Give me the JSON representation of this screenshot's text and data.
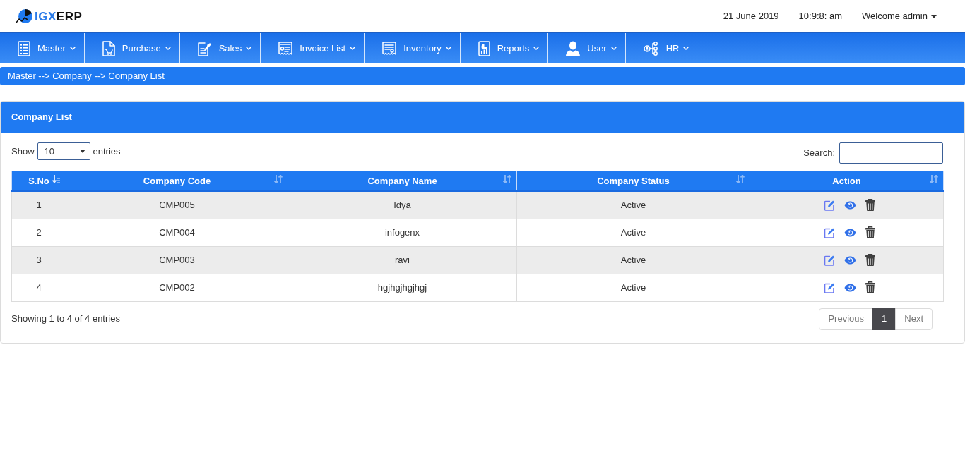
{
  "header": {
    "logo": {
      "accent": "IGX",
      "rest": "ERP"
    },
    "date": "21 June 2019",
    "time": "10:9:8: am",
    "user_menu": "Welcome admin"
  },
  "nav": [
    {
      "label": "Master"
    },
    {
      "label": "Purchase"
    },
    {
      "label": "Sales"
    },
    {
      "label": "Invoice List"
    },
    {
      "label": "Inventory"
    },
    {
      "label": "Reports"
    },
    {
      "label": "User"
    },
    {
      "label": "HR"
    }
  ],
  "breadcrumb": "Master --> Company --> Company List",
  "panel": {
    "title": "Company List",
    "length_menu": {
      "before": "Show",
      "value": "10",
      "after": "entries"
    },
    "search": {
      "label": "Search:"
    },
    "table": {
      "columns": [
        {
          "label": "S.No",
          "sorted": true,
          "kind": "text"
        },
        {
          "label": "Company Code",
          "sorted": false,
          "kind": "text"
        },
        {
          "label": "Company Name",
          "sorted": false,
          "kind": "text"
        },
        {
          "label": "Company Status",
          "sorted": false,
          "kind": "text"
        },
        {
          "label": "Action",
          "sorted": false,
          "kind": "actions"
        }
      ],
      "rows": [
        {
          "cells": [
            "1",
            "CMP005",
            "Idya",
            "Active"
          ]
        },
        {
          "cells": [
            "2",
            "CMP004",
            "infogenx",
            "Active"
          ]
        },
        {
          "cells": [
            "3",
            "CMP003",
            "ravi",
            "Active"
          ]
        },
        {
          "cells": [
            "4",
            "CMP002",
            "hgjhgjhgjhgj",
            "Active"
          ]
        }
      ]
    },
    "info": "Showing 1 to 4 of 4 entries",
    "pagination": [
      {
        "label": "Previous",
        "selected": false,
        "disabled": true
      },
      {
        "label": "1",
        "selected": true,
        "disabled": false
      },
      {
        "label": "Next",
        "selected": false,
        "disabled": true
      }
    ]
  }
}
